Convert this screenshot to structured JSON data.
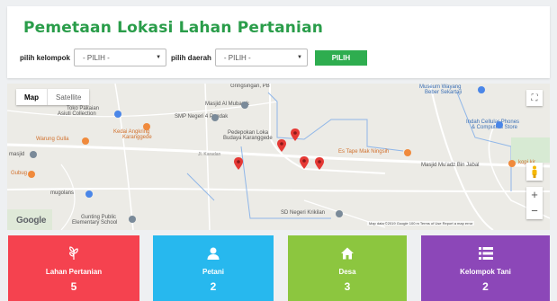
{
  "header": {
    "title": "Pemetaan Lokasi Lahan Pertanian",
    "kelompok_label": "pilih kelompok",
    "kelompok_value": "- PILIH -",
    "daerah_label": "pilih daerah",
    "daerah_value": "- PILIH -",
    "submit_label": "PILIH"
  },
  "map": {
    "type_map": "Map",
    "type_satellite": "Satellite",
    "google": "Google",
    "attribution": "Map data ©2019 Google    100 m           Terms of Use    Report a map error",
    "places": {
      "gringsingan": "Gringsingan, PB",
      "museum_1": "Museum Wayang",
      "museum_2": "Beber Sekartaji",
      "toko_1": "Toko Pakaian",
      "toko_2": "Asiuti Collection",
      "masjid_almubarok": "Masjid Al Mubarok",
      "smp": "SMP Negeri 4 Pandak",
      "indah_1": "Indah Cellular Phones",
      "indah_2": "& Computers Store",
      "kedai_1": "Kedai Angkring",
      "kedai_2": "Karanggede",
      "pedepokan_1": "Pedepokan Loka",
      "pedepokan_2": "Budaya Karanggede",
      "warung": "Warung Gulla",
      "masjid_left": "masjid",
      "karadan": "Jl. Karadan",
      "es_tape": "Es Tape Mak Ningsih",
      "kopi": "kopi kir",
      "masjid_musadz": "Masjid Mu'adz Bin Jabal",
      "gubug": "Gubug",
      "mugolans": "mugolans",
      "gunting_1": "Gunting Public",
      "gunting_2": "Elementary School",
      "sd": "SD Negeri Krikilan"
    }
  },
  "stats": [
    {
      "name": "Lahan Pertanian",
      "count": "5",
      "color": "#f5424f",
      "icon": "leaf-icon"
    },
    {
      "name": "Petani",
      "count": "2",
      "color": "#27b8ee",
      "icon": "user-icon"
    },
    {
      "name": "Desa",
      "count": "3",
      "color": "#8cc63f",
      "icon": "home-icon"
    },
    {
      "name": "Kelompok Tani",
      "count": "2",
      "color": "#8c47b8",
      "icon": "list-icon"
    }
  ],
  "colors": {
    "title_green": "#2a9d4a",
    "button_green": "#2ead4f",
    "pin_red": "#e53935"
  }
}
